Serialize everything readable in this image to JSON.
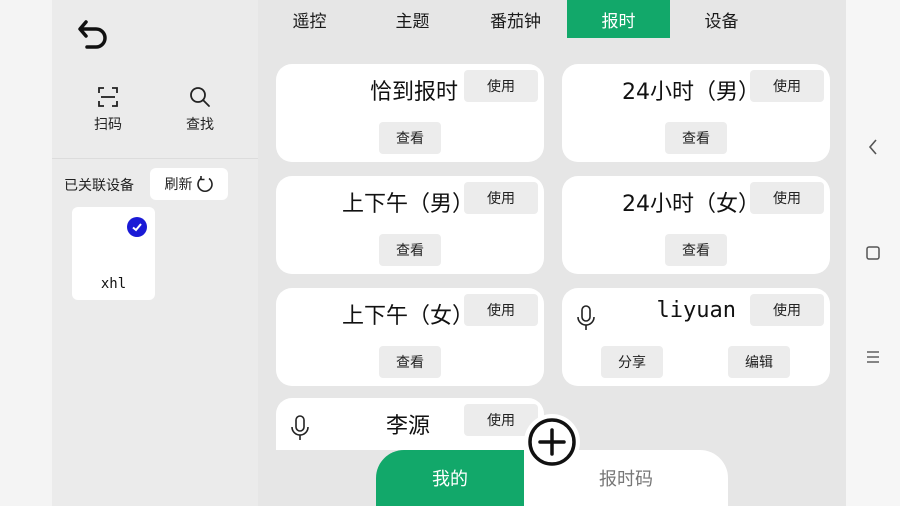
{
  "sidebar": {
    "tools": [
      {
        "label": "扫码",
        "icon": "scan-icon"
      },
      {
        "label": "查找",
        "icon": "search-icon"
      }
    ],
    "assoc_label": "已关联设备",
    "refresh_label": "刷新",
    "devices": [
      {
        "name": "xhl",
        "selected": true
      }
    ]
  },
  "tabs": [
    {
      "label": "遥控",
      "active": false
    },
    {
      "label": "主题",
      "active": false
    },
    {
      "label": "番茄钟",
      "active": false
    },
    {
      "label": "报时",
      "active": true
    },
    {
      "label": "设备",
      "active": false
    }
  ],
  "cards": [
    {
      "title": "恰到报时",
      "use": "使用",
      "view": "查看"
    },
    {
      "title": "24小时（男）",
      "use": "使用",
      "view": "查看"
    },
    {
      "title": "上下午（男）",
      "use": "使用",
      "view": "查看"
    },
    {
      "title": "24小时（女）",
      "use": "使用",
      "view": "查看"
    },
    {
      "title": "上下午（女）",
      "use": "使用",
      "view": "查看"
    },
    {
      "title": "liyuan",
      "use": "使用",
      "share": "分享",
      "edit": "编辑"
    },
    {
      "title": "李源",
      "use": "使用"
    }
  ],
  "bottom_tabs": {
    "mine": "我的",
    "code": "报时码"
  },
  "colors": {
    "accent": "#12a86a",
    "check": "#1a1ad6"
  }
}
